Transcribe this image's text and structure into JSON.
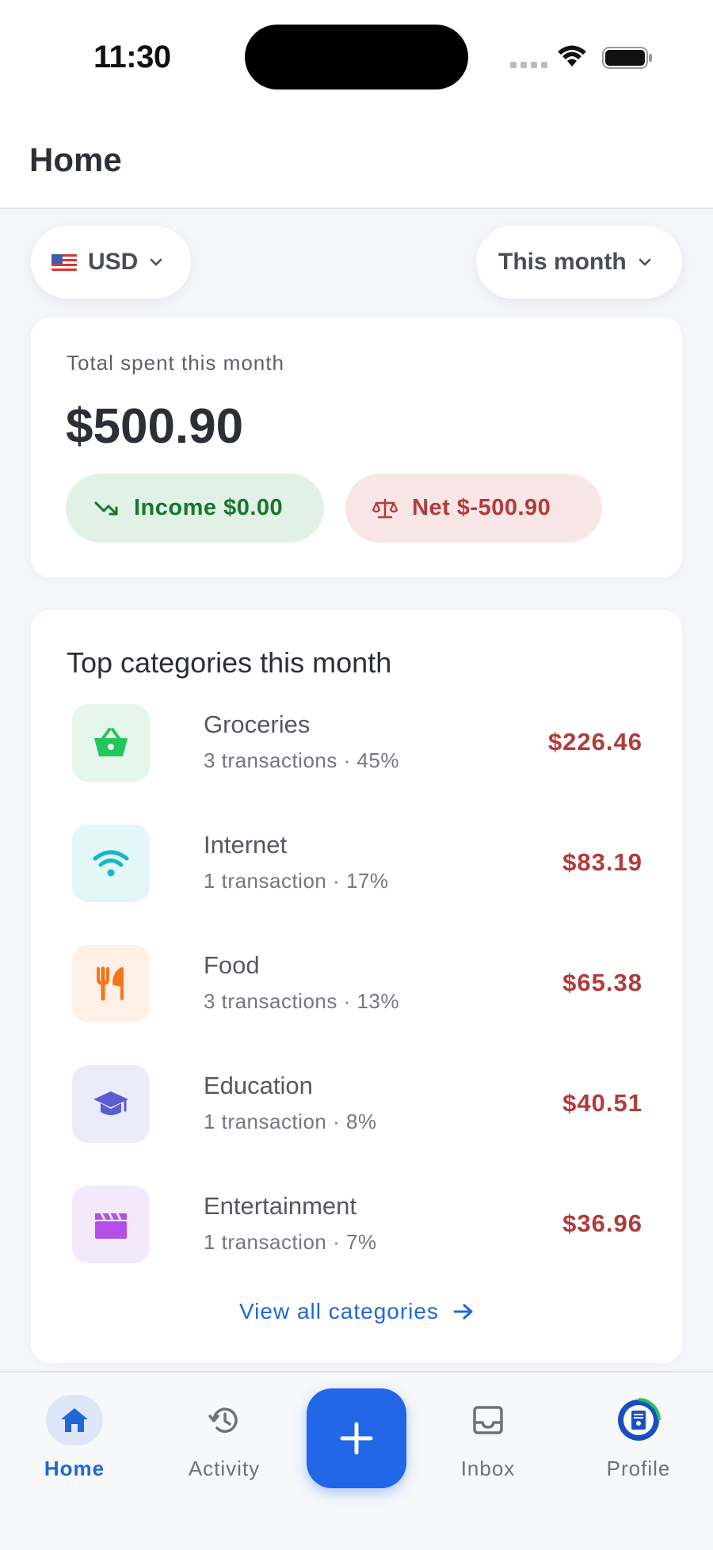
{
  "status_bar": {
    "time": "11:30"
  },
  "header": {
    "title": "Home"
  },
  "filters": {
    "currency": "USD",
    "period": "This month"
  },
  "summary": {
    "label": "Total spent this month",
    "amount": "$500.90",
    "income": "Income $0.00",
    "net": "Net $-500.90"
  },
  "categories": {
    "title": "Top categories this month",
    "items": [
      {
        "name": "Groceries",
        "meta": "3 transactions · 45%",
        "amount": "$226.46",
        "icon": "basket-icon",
        "color": "#22c55e",
        "bg": "#e6f6ea"
      },
      {
        "name": "Internet",
        "meta": "1 transaction · 17%",
        "amount": "$83.19",
        "icon": "wifi-icon",
        "color": "#14b8c8",
        "bg": "#e3f6f8"
      },
      {
        "name": "Food",
        "meta": "3 transactions · 13%",
        "amount": "$65.38",
        "icon": "utensils-icon",
        "color": "#f5761a",
        "bg": "#fdf0e6"
      },
      {
        "name": "Education",
        "meta": "1 transaction · 8%",
        "amount": "$40.51",
        "icon": "graduation-cap-icon",
        "color": "#5b5bd6",
        "bg": "#ecebfb"
      },
      {
        "name": "Entertainment",
        "meta": "1 transaction · 7%",
        "amount": "$36.96",
        "icon": "clapperboard-icon",
        "color": "#b14fe6",
        "bg": "#f3e9fb"
      }
    ],
    "view_all": "View all categories"
  },
  "nav": {
    "home": "Home",
    "activity": "Activity",
    "inbox": "Inbox",
    "profile": "Profile"
  },
  "colors": {
    "accent": "#2266e8",
    "expense": "#b13b3b",
    "income": "#18752f"
  }
}
